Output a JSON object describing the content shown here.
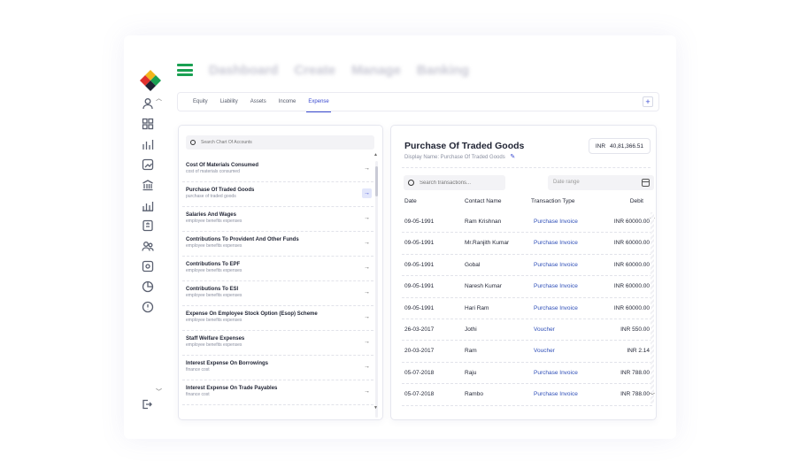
{
  "topnav": {
    "items": [
      "Dashboard",
      "Create",
      "Manage",
      "Banking"
    ]
  },
  "tabs": [
    {
      "label": "Equity"
    },
    {
      "label": "Liability"
    },
    {
      "label": "Assets"
    },
    {
      "label": "Income"
    },
    {
      "label": "Expense",
      "active": true
    }
  ],
  "tab_add_label": "+",
  "accounts": {
    "search_placeholder": "Search Chart Of Accounts",
    "items": [
      {
        "name": "Cost Of Materials Consumed",
        "sub": "cost of materials consumed"
      },
      {
        "name": "Purchase Of Traded Goods",
        "sub": "purchase of traded goods",
        "selected": true
      },
      {
        "name": "Salaries And Wages",
        "sub": "employee benefits expenses"
      },
      {
        "name": "Contributions To Provident And Other Funds",
        "sub": "employee benefits expenses"
      },
      {
        "name": "Contributions To EPF",
        "sub": "employee benefits expenses"
      },
      {
        "name": "Contributions To ESI",
        "sub": "employee benefits expenses"
      },
      {
        "name": "Expense On Employee Stock Option (Esop) Scheme",
        "sub": "employee benefits expenses"
      },
      {
        "name": "Staff Welfare Expenses",
        "sub": "employee benefits expenses"
      },
      {
        "name": "Interest Expense On Borrowings",
        "sub": "finance cost"
      },
      {
        "name": "Interest Expense On Trade Payables",
        "sub": "finance cost"
      }
    ]
  },
  "detail": {
    "title": "Purchase Of Traded Goods",
    "display_name": "Display Name: Purchase Of Traded Goods",
    "currency": "INR",
    "balance": "40,81,366.51",
    "search_placeholder": "Search transactions...",
    "date_range_placeholder": "Date range",
    "columns": {
      "date": "Date",
      "contact": "Contact Name",
      "type": "Transaction Type",
      "debit": "Debit"
    },
    "rows": [
      {
        "date": "09-05-1991",
        "contact": "Ram Krishnan",
        "type": "Purchase Invoice",
        "debit": "INR 60000.00"
      },
      {
        "date": "09-05-1991",
        "contact": "Mr.Ranjith Kumar",
        "type": "Purchase Invoice",
        "debit": "INR 60000.00"
      },
      {
        "date": "09-05-1991",
        "contact": "Gobal",
        "type": "Purchase Invoice",
        "debit": "INR 60000.00"
      },
      {
        "date": "09-05-1991",
        "contact": "Naresh Kumar",
        "type": "Purchase Invoice",
        "debit": "INR 60000.00"
      },
      {
        "date": "09-05-1991",
        "contact": "Hari Ram",
        "type": "Purchase Invoice",
        "debit": "INR 60000.00"
      },
      {
        "date": "26-03-2017",
        "contact": "Jothi",
        "type": "Voucher",
        "debit": "INR 550.00"
      },
      {
        "date": "20-03-2017",
        "contact": "Ram",
        "type": "Voucher",
        "debit": "INR 2.14"
      },
      {
        "date": "05-07-2018",
        "contact": "Raju",
        "type": "Purchase Invoice",
        "debit": "INR 788.00"
      },
      {
        "date": "05-07-2018",
        "contact": "Rambo",
        "type": "Purchase Invoice",
        "debit": "INR 788.00"
      }
    ]
  },
  "colors": {
    "accent": "#3a4ad0",
    "link": "#2f4fb8",
    "menu_green": "#1aa052"
  },
  "sidebar_icons": [
    "user-icon",
    "grid-icon",
    "bar-chart-icon",
    "chart-up-icon",
    "bank-icon",
    "report-icon",
    "invoice-icon",
    "contacts-icon",
    "settings-doc-icon",
    "pie-icon",
    "info-icon"
  ]
}
